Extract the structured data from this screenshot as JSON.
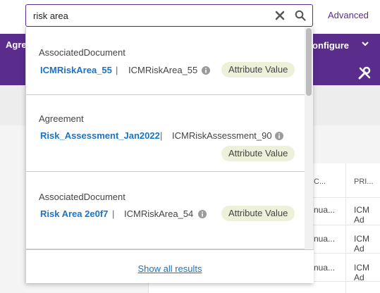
{
  "search": {
    "value": "risk area",
    "advanced_label": "Advanced"
  },
  "background": {
    "tab_partial": "Agre",
    "configure_label": "onfigure",
    "column_headers": [
      "C...",
      "PRI..."
    ],
    "rows": [
      [
        "nua...",
        "ICM Ad"
      ],
      [
        "nua...",
        "ICM Ad"
      ],
      [
        "nua...",
        "ICM Ad"
      ]
    ]
  },
  "results": [
    {
      "type": "AssociatedDocument",
      "name": "ICMRiskArea_55",
      "id": "ICMRiskArea_55",
      "badge": "Attribute Value"
    },
    {
      "type": "Agreement",
      "name": "Risk_Assessment_Jan2022",
      "id": "ICMRiskAssessment_90",
      "badge": "Attribute Value"
    },
    {
      "type": "AssociatedDocument",
      "name": "Risk Area 2e0f7",
      "id": "ICMRiskArea_54",
      "badge": "Attribute Value"
    }
  ],
  "separator": "|",
  "footer": {
    "show_all_label": "Show all results"
  },
  "icons": {
    "clear": "close-icon",
    "search": "search-icon",
    "info": "info-icon",
    "tools": "tools-icon",
    "chevron": "chevron-down-icon"
  },
  "colors": {
    "brand_purple": "#5a2d8c",
    "link_blue": "#1a73c8",
    "badge_bg": "#eef1d9"
  }
}
